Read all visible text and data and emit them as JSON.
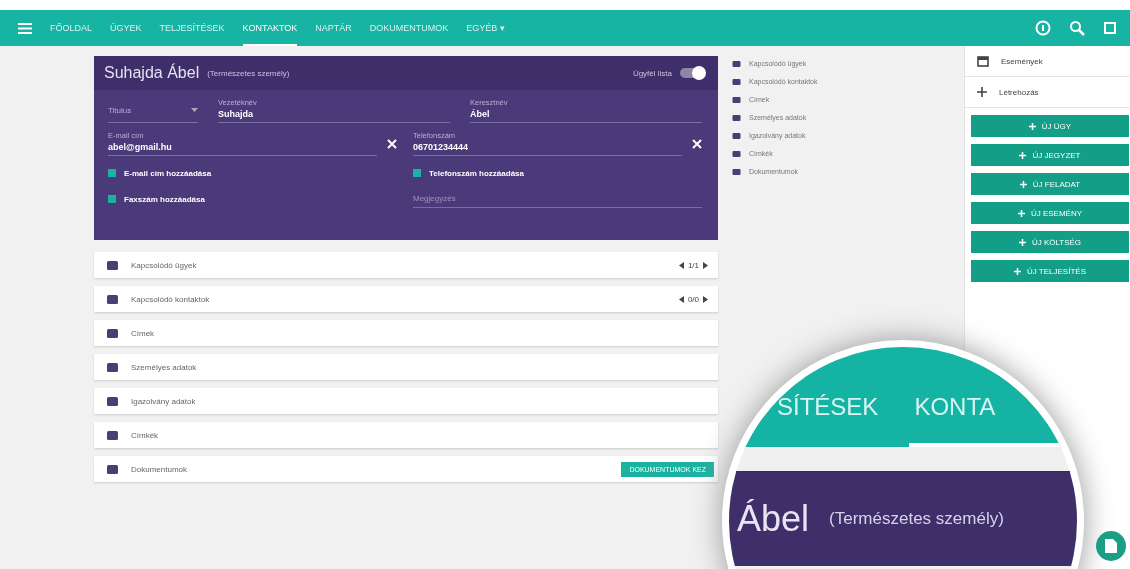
{
  "nav": {
    "tabs": [
      {
        "label": "FŐOLDAL",
        "selected": false
      },
      {
        "label": "ÜGYEK",
        "selected": false
      },
      {
        "label": "TELJESÍTÉSEK",
        "selected": false
      },
      {
        "label": "KONTAKTOK",
        "selected": true
      },
      {
        "label": "NAPTÁR",
        "selected": false
      },
      {
        "label": "DOKUMENTUMOK",
        "selected": false
      },
      {
        "label": "EGYÉB ▾",
        "selected": false
      }
    ]
  },
  "card": {
    "name": "Suhajda Ábel",
    "type": "(Természetes személy)",
    "toggle": {
      "label": "Ügyfél lista",
      "on": true
    },
    "title_select": {
      "placeholder": "Titulus"
    },
    "fields": [
      {
        "label": "Vezetéknév",
        "value": "Suhajda"
      },
      {
        "label": "Keresztnév",
        "value": "Ábel"
      },
      {
        "label": "E-mail cím",
        "value": "abel@gmail.hu"
      },
      {
        "label": "Telefonszám",
        "value": "06701234444"
      }
    ],
    "checkboxes": [
      {
        "label": "E-mail cím hozzáadása",
        "checked": true
      },
      {
        "label": "Telefonszám hozzáadása",
        "checked": true
      },
      {
        "label": "Faxszám hozzáadása",
        "checked": true
      }
    ],
    "note": {
      "placeholder": "Megjegyzés"
    }
  },
  "sections": [
    {
      "label": "Kapcsolódó ügyek",
      "pager": "1/1"
    },
    {
      "label": "Kapcsolódó kontaktok",
      "pager": "0/0"
    },
    {
      "label": "Címek"
    },
    {
      "label": "Személyes adatok"
    },
    {
      "label": "Igazolvány adatok"
    },
    {
      "label": "Címkék"
    },
    {
      "label": "Dokumentumok",
      "button": "DOKUMENTUMOK KEZ"
    }
  ],
  "jump_links": [
    {
      "label": "Kapcsolódó ügyek"
    },
    {
      "label": "Kapcsolódó kontaktok"
    },
    {
      "label": "Címek"
    },
    {
      "label": "Személyes adatok"
    },
    {
      "label": "Igazolvány adatok"
    },
    {
      "label": "Címkék"
    },
    {
      "label": "Dokumentumok"
    }
  ],
  "side_panel": {
    "events": "Események",
    "create": "Létrehozás",
    "buttons": [
      "ÚJ ÜGY",
      "ÚJ JEGYZET",
      "ÚJ FELADAT",
      "ÚJ ESEMÉNY",
      "ÚJ KÖLTSÉG",
      "ÚJ TELJESÍTÉS"
    ]
  },
  "magnifier": {
    "tabs": [
      "SÍTÉSEK",
      "KONTA"
    ],
    "name": "Ábel",
    "type": "(Természetes személy)"
  }
}
